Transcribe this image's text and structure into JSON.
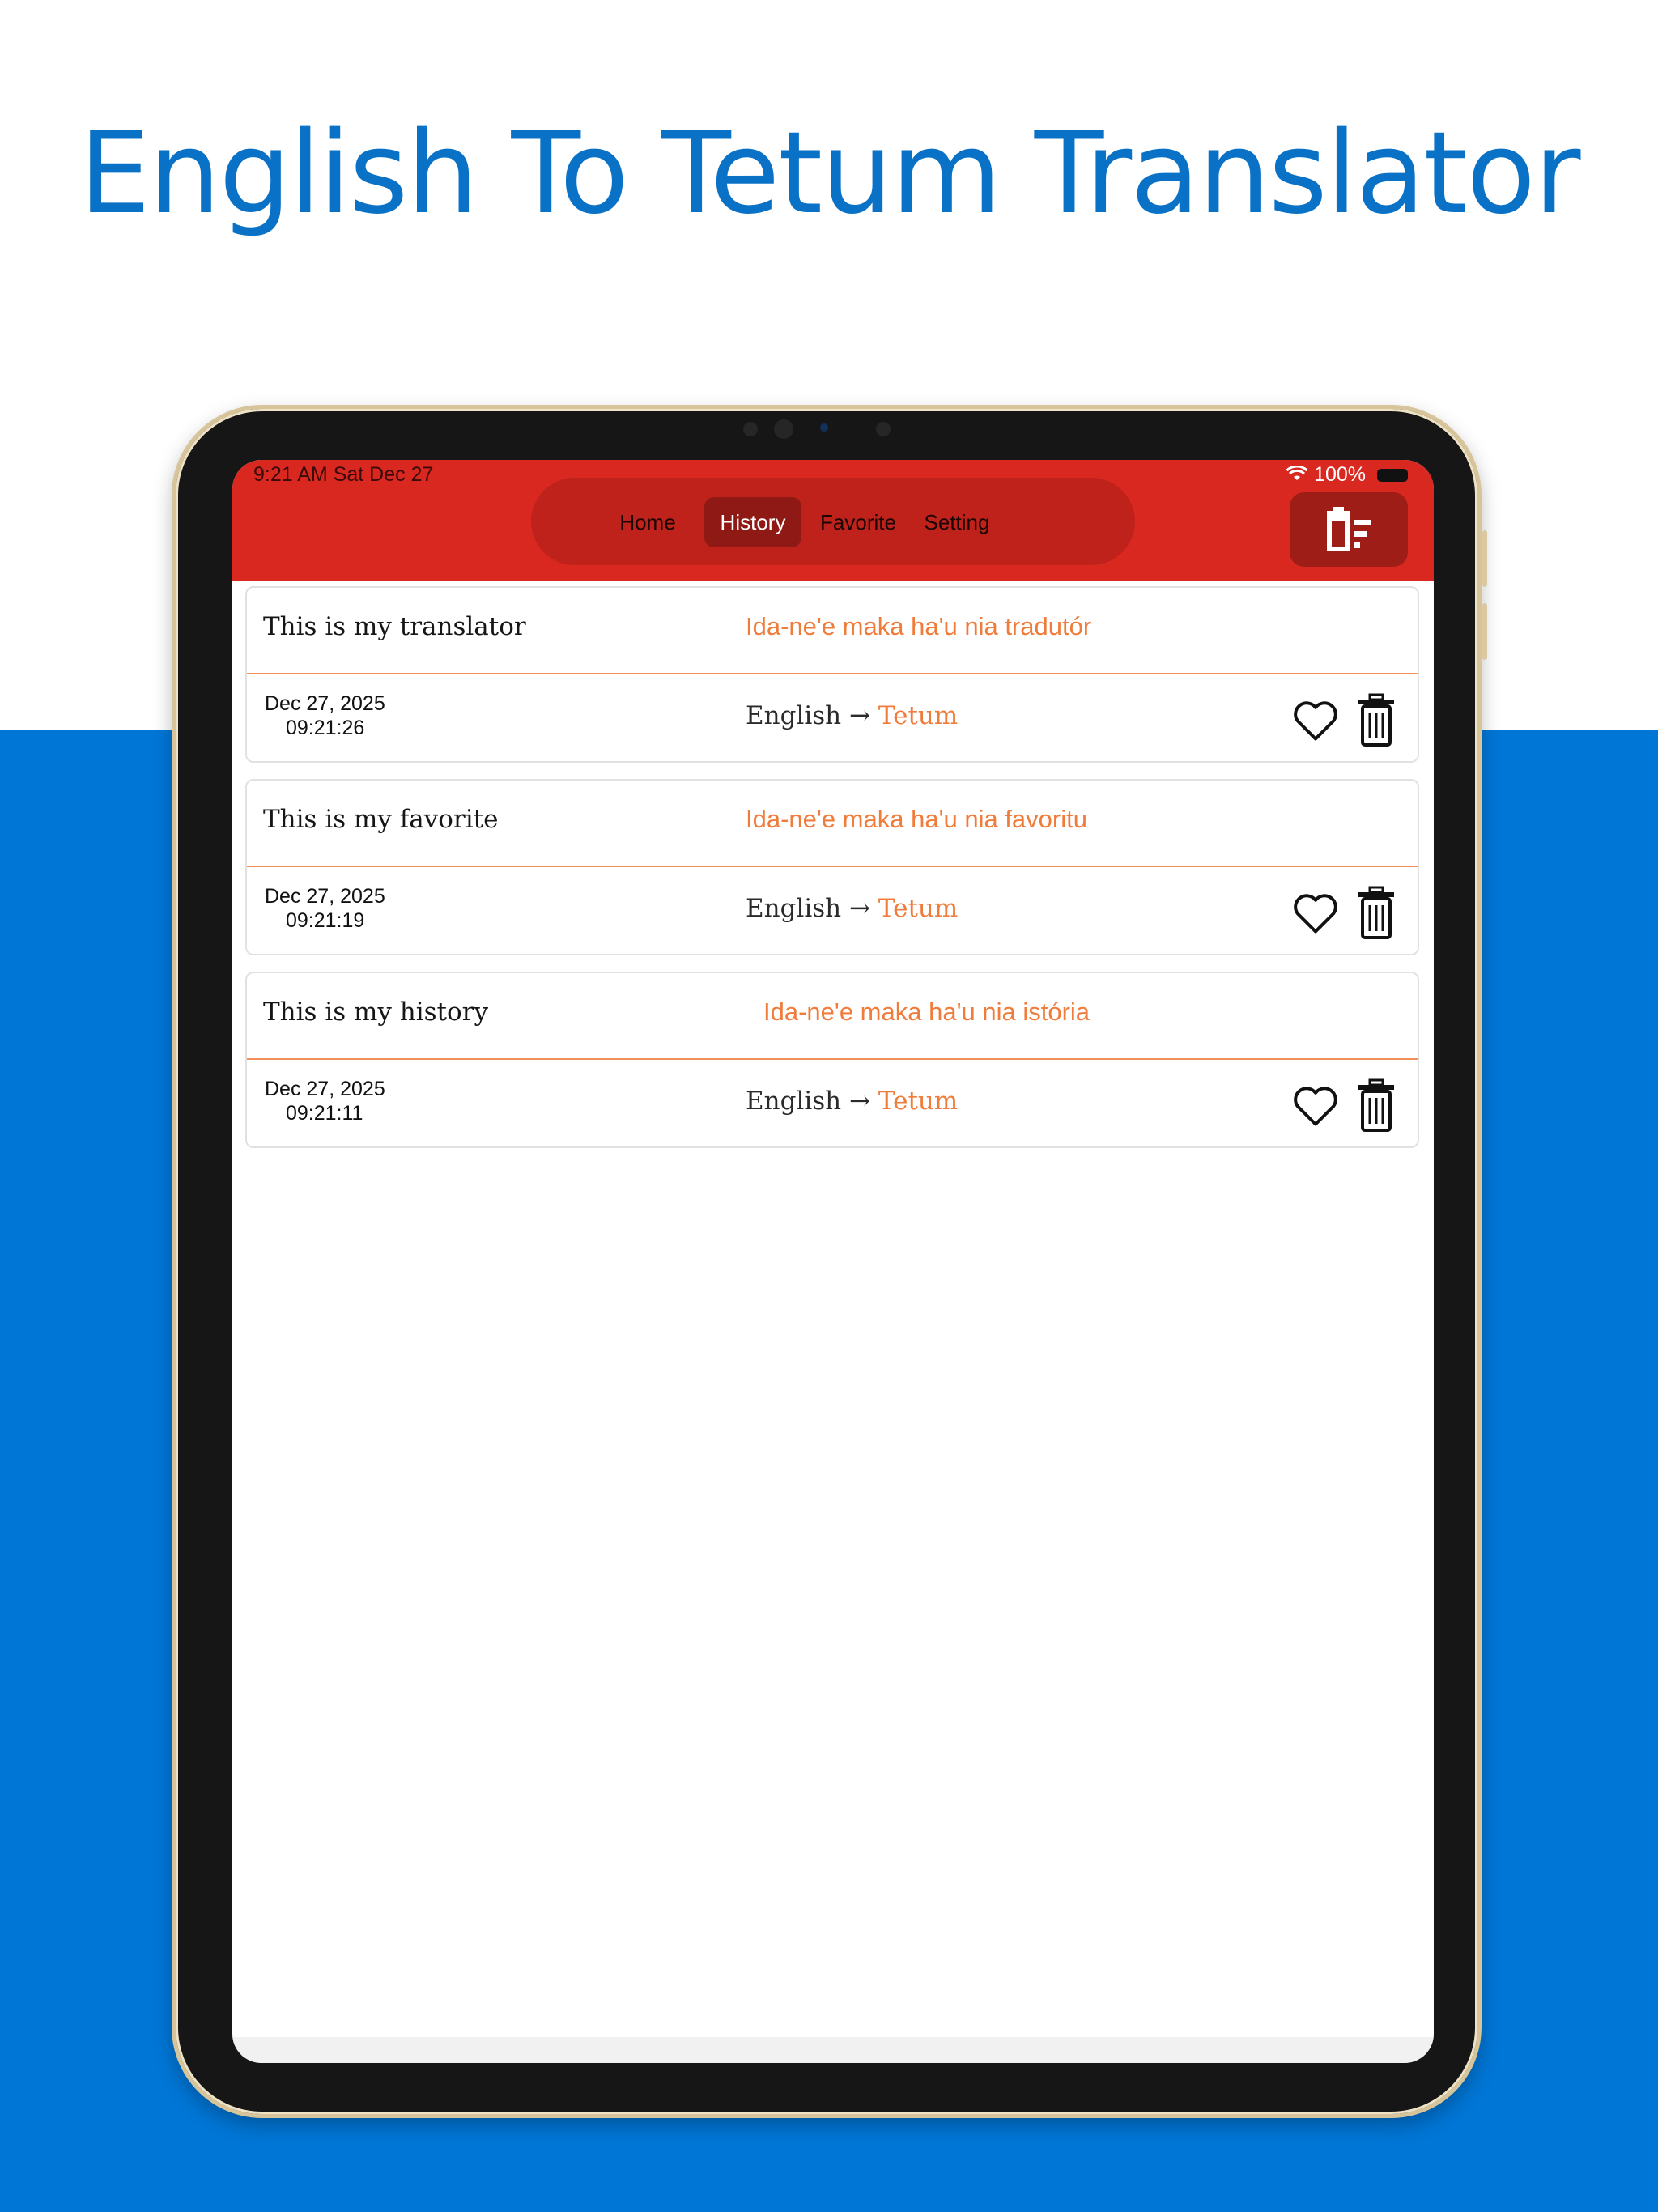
{
  "headline": "English To Tetum Translator",
  "status_bar": {
    "time": "9:21 AM   Sat Dec 27",
    "battery": "100%"
  },
  "nav": {
    "tabs": [
      "Home",
      "History",
      "Favorite",
      "Setting"
    ],
    "active_tab": "History"
  },
  "history": [
    {
      "source": "This is my translator",
      "translation": "Ida-ne'e maka ha'u nia tradutór",
      "date": "Dec 27, 2025",
      "time": "09:21:26",
      "from_lang": "English",
      "arrow": "→",
      "to_lang": "Tetum"
    },
    {
      "source": "This is my favorite",
      "translation": "Ida-ne'e maka ha'u nia favoritu",
      "date": "Dec 27, 2025",
      "time": "09:21:19",
      "from_lang": "English",
      "arrow": "→",
      "to_lang": "Tetum"
    },
    {
      "source": "This is my history",
      "translation": "Ida-ne'e maka ha'u nia istória",
      "date": "Dec 27, 2025",
      "time": "09:21:11",
      "from_lang": "English",
      "arrow": "→",
      "to_lang": "Tetum"
    }
  ],
  "colors": {
    "accent_red": "#d8281f",
    "accent_orange": "#f07c3b",
    "brand_blue": "#0076d6"
  },
  "icons": {
    "clear_all": "trash-list-icon",
    "favorite": "heart-outline-icon",
    "delete": "trash-icon"
  }
}
